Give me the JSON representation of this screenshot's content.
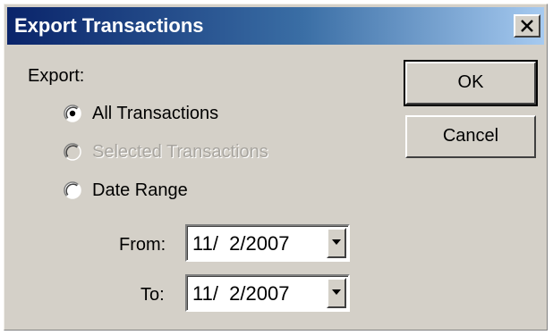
{
  "window": {
    "title": "Export Transactions",
    "close_label": "Close"
  },
  "export": {
    "label": "Export:",
    "options": [
      {
        "label": "All Transactions",
        "selected": true,
        "enabled": true
      },
      {
        "label": "Selected Transactions",
        "selected": false,
        "enabled": false
      },
      {
        "label": "Date Range",
        "selected": false,
        "enabled": true
      }
    ]
  },
  "date_range": {
    "from_label": "From:",
    "from_value": "11/  2/2007",
    "to_label": "To:",
    "to_value": "11/  2/2007"
  },
  "buttons": {
    "ok_label": "OK",
    "cancel_label": "Cancel"
  }
}
